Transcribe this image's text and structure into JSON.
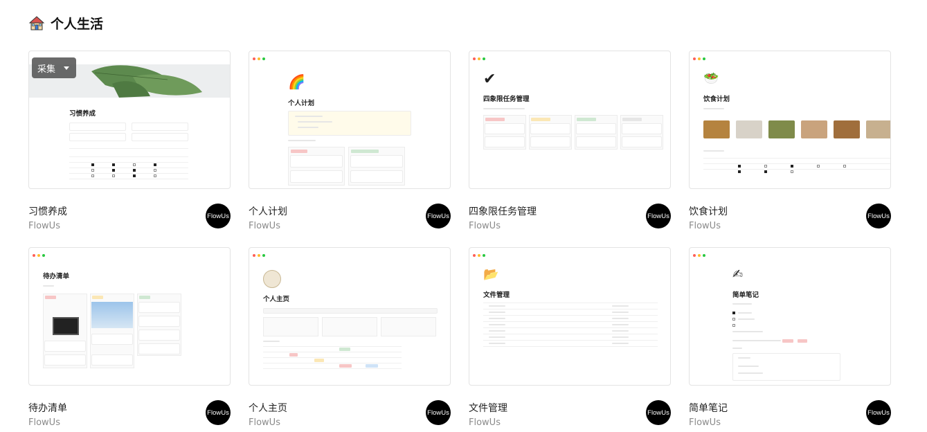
{
  "section": {
    "title": "个人生活",
    "icon": "house-icon"
  },
  "collect_button": {
    "label": "采集"
  },
  "cards": [
    {
      "title": "习惯养成",
      "author": "FlowUs",
      "badge": "FlowUs",
      "preview": {
        "heading": "习惯养成"
      }
    },
    {
      "title": "个人计划",
      "author": "FlowUs",
      "badge": "FlowUs",
      "preview": {
        "heading": "个人计划",
        "icon": "🌈"
      }
    },
    {
      "title": "四象限任务管理",
      "author": "FlowUs",
      "badge": "FlowUs",
      "preview": {
        "heading": "四象限任务管理",
        "icon": "✔"
      }
    },
    {
      "title": "饮食计划",
      "author": "FlowUs",
      "badge": "FlowUs",
      "preview": {
        "heading": "饮食计划",
        "icon": "🥗"
      }
    },
    {
      "title": "待办清单",
      "author": "FlowUs",
      "badge": "FlowUs",
      "preview": {
        "heading": "待办清单"
      }
    },
    {
      "title": "个人主页",
      "author": "FlowUs",
      "badge": "FlowUs",
      "preview": {
        "heading": "个人主页"
      }
    },
    {
      "title": "文件管理",
      "author": "FlowUs",
      "badge": "FlowUs",
      "preview": {
        "heading": "文件管理",
        "icon": "📂"
      }
    },
    {
      "title": "简单笔记",
      "author": "FlowUs",
      "badge": "FlowUs",
      "preview": {
        "heading": "简单笔记",
        "icon": "✍"
      }
    }
  ],
  "colors": {
    "badge_bg": "#000000",
    "border": "#e3e3e3",
    "author_text": "#8a8a8a",
    "dot_red": "#ff5f57",
    "dot_yellow": "#febc2e",
    "dot_green": "#28c840"
  }
}
